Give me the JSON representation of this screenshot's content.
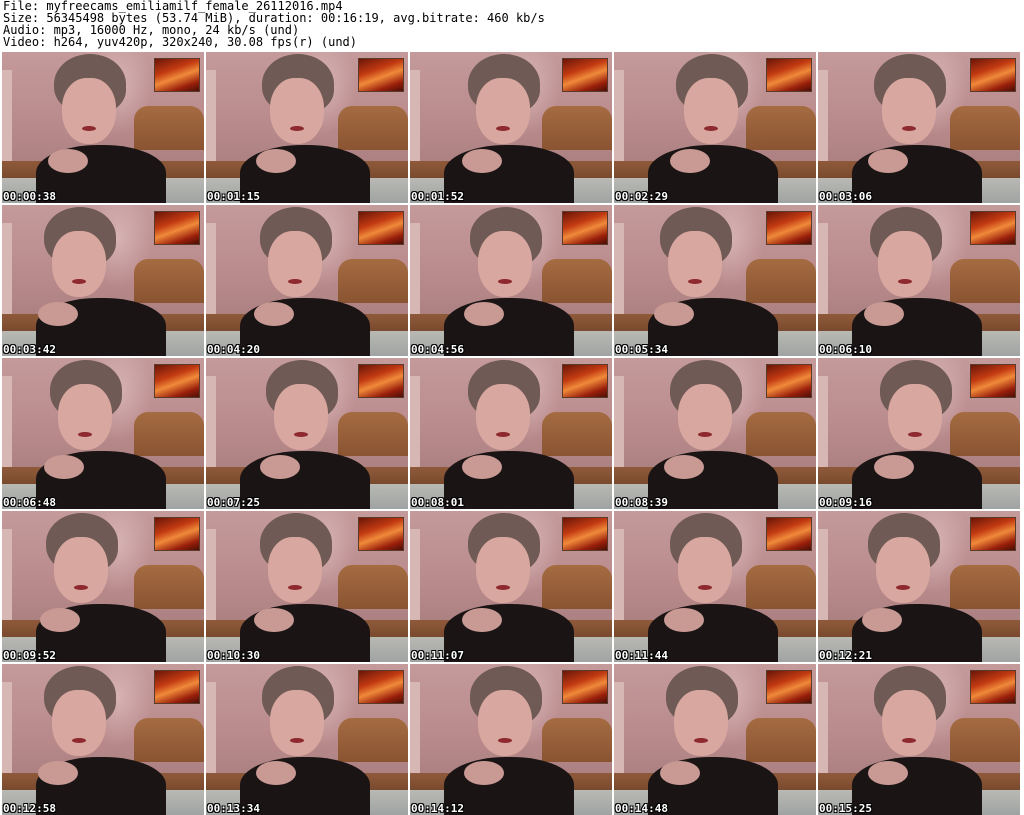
{
  "header": {
    "file_line": "File: myfreecams_emiliamilf_female_26112016.mp4",
    "size_line": "Size: 56345498 bytes (53.74 MiB), duration: 00:16:19, avg.bitrate: 460 kb/s",
    "audio_line": "Audio: mp3, 16000 Hz, mono, 24 kb/s (und)",
    "video_line": "Video: h264, yuv420p, 320x240, 30.08 fps(r) (und)"
  },
  "thumbnails": [
    {
      "timestamp": "00:00:38"
    },
    {
      "timestamp": "00:01:15"
    },
    {
      "timestamp": "00:01:52"
    },
    {
      "timestamp": "00:02:29"
    },
    {
      "timestamp": "00:03:06"
    },
    {
      "timestamp": "00:03:42"
    },
    {
      "timestamp": "00:04:20"
    },
    {
      "timestamp": "00:04:56"
    },
    {
      "timestamp": "00:05:34"
    },
    {
      "timestamp": "00:06:10"
    },
    {
      "timestamp": "00:06:48"
    },
    {
      "timestamp": "00:07:25"
    },
    {
      "timestamp": "00:08:01"
    },
    {
      "timestamp": "00:08:39"
    },
    {
      "timestamp": "00:09:16"
    },
    {
      "timestamp": "00:09:52"
    },
    {
      "timestamp": "00:10:30"
    },
    {
      "timestamp": "00:11:07"
    },
    {
      "timestamp": "00:11:44"
    },
    {
      "timestamp": "00:12:21"
    },
    {
      "timestamp": "00:12:58"
    },
    {
      "timestamp": "00:13:34"
    },
    {
      "timestamp": "00:14:12"
    },
    {
      "timestamp": "00:14:48"
    },
    {
      "timestamp": "00:15:25"
    }
  ],
  "colors": {
    "background": "#ffffff",
    "header_text": "#000000",
    "timestamp_text": "#ffffff",
    "timestamp_outline": "#000000"
  }
}
